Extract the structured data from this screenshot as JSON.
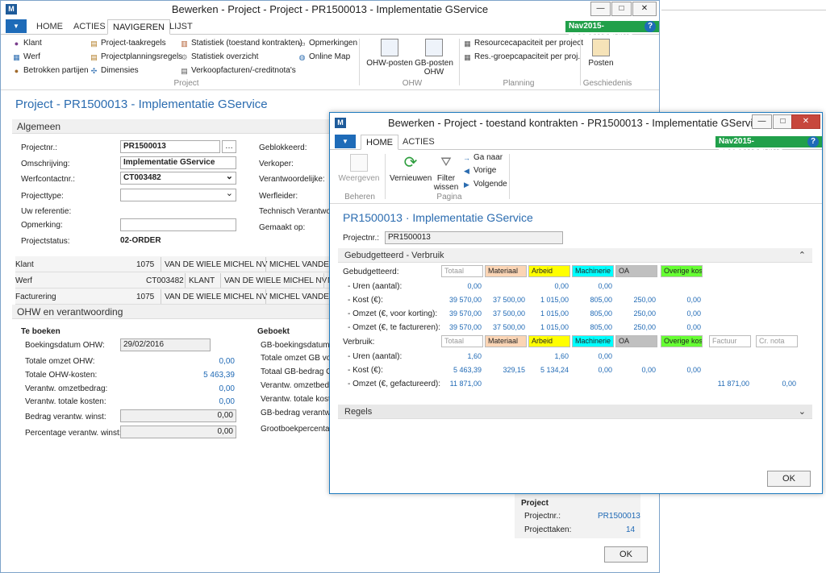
{
  "main": {
    "title": "Bewerken - Project - Project - PR1500013 - Implementatie GService",
    "env": "Nav2015-TESTOMGEVING",
    "tabs": [
      "HOME",
      "ACTIES",
      "NAVIGEREN",
      "LIJST"
    ],
    "ribbon": {
      "col1": [
        "Klant",
        "Werf",
        "Betrokken partijen"
      ],
      "col2": [
        "Project-taakregels",
        "Projectplanningsregels",
        "Dimensies"
      ],
      "col3": [
        "Statistiek (toestand kontrakten)",
        "Statistiek overzicht",
        "Verkoopfacturen/-creditnota's"
      ],
      "col4": [
        "Opmerkingen",
        "Online Map"
      ],
      "group1": "Project",
      "ohw1": "OHW-posten",
      "ohw2": "GB-posten OHW",
      "group2": "OHW",
      "plan1": "Resourcecapaciteit per project",
      "plan2": "Res.-groepcapaciteit per proj.",
      "group3": "Planning",
      "posten": "Posten",
      "group4": "Geschiedenis"
    },
    "page_title": "Project - PR1500013 - Implementatie GService",
    "algemeen": "Algemeen",
    "fields": {
      "projectnr_l": "Projectnr.:",
      "projectnr": "PR1500013",
      "omschr_l": "Omschrijving:",
      "omschr": "Implementatie GService",
      "werfc_l": "Werfcontactnr.:",
      "werfc": "CT003482",
      "ptype_l": "Projecttype:",
      "uwref_l": "Uw referentie:",
      "opm_l": "Opmerking:",
      "status_l": "Projectstatus:",
      "status": "02-ORDER",
      "gebl_l": "Geblokkeerd:",
      "verk_l": "Verkoper:",
      "verantw_l": "Verantwoordelijke:",
      "werfl_l": "Werfleider:",
      "techv_l": "Technisch Verantwoor",
      "gemaakt_l": "Gemaakt op:"
    },
    "klant": {
      "label": "Klant",
      "nr": "1075",
      "name": "VAN DE WIELE MICHEL NV",
      "contact": "MICHEL VANDEWIELEST"
    },
    "werf": {
      "label": "Werf",
      "nr": "CT003482",
      "type": "KLANT",
      "name": "VAN DE WIELE MICHEL NV",
      "n": "N"
    },
    "fact": {
      "label": "Facturering",
      "nr": "1075",
      "name": "VAN DE WIELE MICHEL NV",
      "contact": "MICHEL VANDEWIELEST"
    },
    "ohw": {
      "label": "OHW en verantwoording",
      "te_boeken": "Te boeken",
      "bdatum_l": "Boekingsdatum OHW:",
      "bdatum": "29/02/2016",
      "tomzet_l": "Totale omzet OHW:",
      "tomzet": "0,00",
      "tkost_l": "Totale OHW-kosten:",
      "tkost": "5 463,39",
      "vomzet_l": "Verantw. omzetbedrag:",
      "vomzet": "0,00",
      "vtkost_l": "Verantw. totale kosten:",
      "vtkost": "0,00",
      "bwinst_l": "Bedrag verantw. winst:",
      "bwinst": "0,00",
      "pwinst_l": "Percentage verantw. winst:",
      "pwinst": "0,00",
      "geboekt": "Geboekt",
      "g1": "GB-boekingsdatum O",
      "g2": "Totale omzet GB voor",
      "g3": "Totaal GB-bedrag OH",
      "g4": "Verantw. omzetbedra",
      "g5": "Verantw. totale koste",
      "g6": "GB-bedrag verantw. w",
      "g7": "Grootboekpercentage"
    },
    "factbox": {
      "title": "Project",
      "pnr_l": "Projectnr.:",
      "pnr": "PR1500013",
      "ptak_l": "Projecttaken:",
      "ptak": "14"
    },
    "ok": "OK"
  },
  "dlg": {
    "title": "Bewerken - Project - toestand kontrakten - PR1500013 - Implementatie GService",
    "env": "Nav2015-TESTOMGEVING",
    "tabs": [
      "HOME",
      "ACTIES"
    ],
    "weergeven": "Weergeven",
    "beheren": "Beheren",
    "vernieuwen": "Vernieuwen",
    "filter": "Filter wissen",
    "ganaar": "Ga naar",
    "vorige": "Vorige",
    "volgende": "Volgende",
    "pagina": "Pagina",
    "page_title": "PR1500013 · Implementatie GService",
    "pnr_l": "Projectnr.:",
    "pnr": "PR1500013",
    "section": "Gebudgetteerd - Verbruik",
    "regels": "Regels",
    "ok": "OK",
    "budget_label": "Gebudgetteerd:",
    "budget_cols": [
      "Totaal",
      "Materiaal",
      "Arbeid",
      "Machinerie",
      "OA",
      "Overige kost"
    ],
    "budget_rows": [
      {
        "label": "- Uren (aantal):",
        "vals": [
          "0,00",
          "",
          "0,00",
          "0,00",
          "",
          ""
        ]
      },
      {
        "label": "- Kost (€):",
        "vals": [
          "39 570,00",
          "37 500,00",
          "1 015,00",
          "805,00",
          "250,00",
          "0,00"
        ]
      },
      {
        "label": "- Omzet (€, voor korting):",
        "vals": [
          "39 570,00",
          "37 500,00",
          "1 015,00",
          "805,00",
          "250,00",
          "0,00"
        ]
      },
      {
        "label": "- Omzet (€, te factureren):",
        "vals": [
          "39 570,00",
          "37 500,00",
          "1 015,00",
          "805,00",
          "250,00",
          "0,00"
        ]
      }
    ],
    "verb_label": "Verbruik:",
    "verb_cols": [
      "Totaal",
      "Materiaal",
      "Arbeid",
      "Machinerie",
      "OA",
      "Overige kost",
      "Factuur",
      "Cr. nota"
    ],
    "verb_rows": [
      {
        "label": "- Uren (aantal):",
        "vals": [
          "1,60",
          "",
          "1,60",
          "0,00",
          "",
          "",
          "",
          ""
        ]
      },
      {
        "label": "- Kost (€):",
        "vals": [
          "5 463,39",
          "329,15",
          "5 134,24",
          "0,00",
          "0,00",
          "0,00",
          "",
          ""
        ]
      },
      {
        "label": "- Omzet (€, gefactureerd):",
        "vals": [
          "11 871,00",
          "",
          "",
          "",
          "",
          "",
          "11 871,00",
          "0,00"
        ]
      }
    ],
    "colors": {
      "Materiaal": "#fbd5b5",
      "Arbeid": "#ffff00",
      "Machinerie": "#00ffff",
      "OA": "#c0c0c0",
      "Overige kost": "#66ff33"
    }
  }
}
